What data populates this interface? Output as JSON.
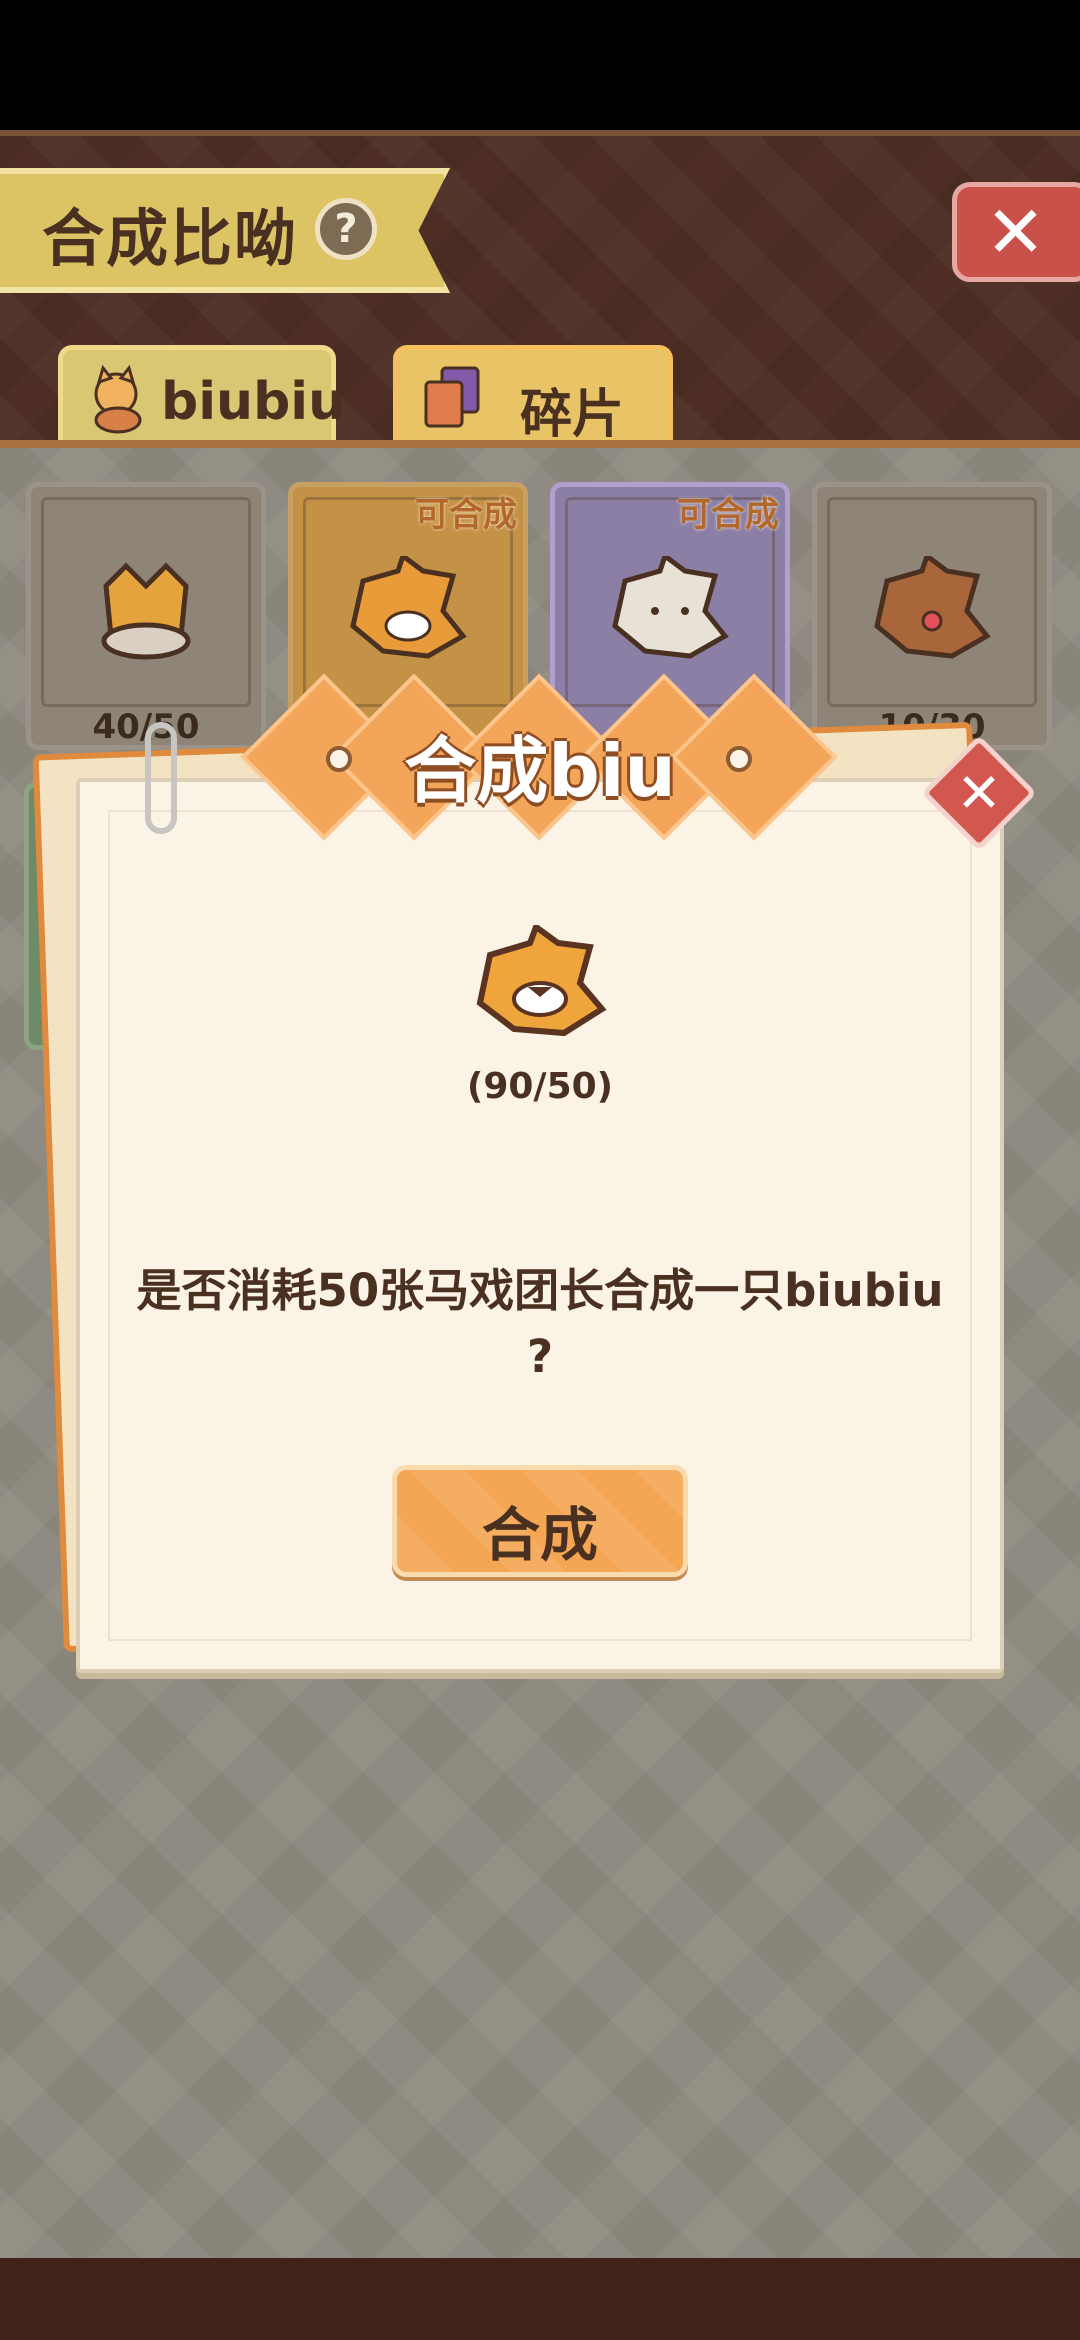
{
  "header": {
    "title": "合成比呦",
    "help_icon": "?"
  },
  "tabs": [
    {
      "label": "biubiu",
      "icon": "cat-icon"
    },
    {
      "label": "碎片",
      "icon": "cards-icon"
    }
  ],
  "cards": [
    {
      "count": "40/50",
      "tag": ""
    },
    {
      "count": "",
      "tag": "可合成"
    },
    {
      "count": "",
      "tag": "可合成"
    },
    {
      "count": "10/30",
      "tag": ""
    }
  ],
  "dialog": {
    "title": "合成biu",
    "progress": "(90/50)",
    "question": "是否消耗50张马戏团长合成一只biubiu ?",
    "confirm_label": "合成",
    "close_glyph": "✕"
  },
  "colors": {
    "accent": "#f4a655",
    "header_bg": "#4e2e24",
    "close_red": "#c9514a"
  }
}
